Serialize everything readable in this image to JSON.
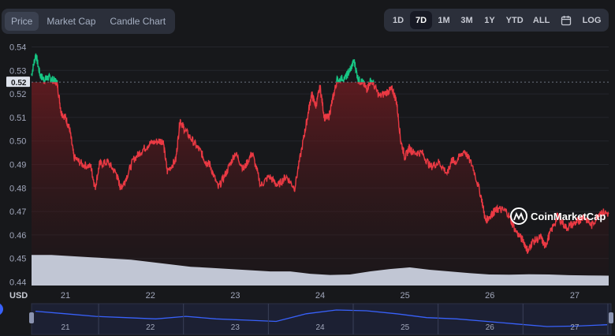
{
  "tabs": [
    {
      "label": "Price",
      "active": true
    },
    {
      "label": "Market Cap",
      "active": false
    },
    {
      "label": "Candle Chart",
      "active": false
    }
  ],
  "ranges": [
    {
      "label": "1D",
      "active": false
    },
    {
      "label": "7D",
      "active": true
    },
    {
      "label": "1M",
      "active": false
    },
    {
      "label": "3M",
      "active": false
    },
    {
      "label": "1Y",
      "active": false
    },
    {
      "label": "YTD",
      "active": false
    },
    {
      "label": "ALL",
      "active": false
    },
    {
      "icon": "calendar-icon"
    },
    {
      "label": "LOG",
      "active": false
    }
  ],
  "watermark": "CoinMarketCap",
  "colors": {
    "up": "#16c784",
    "down": "#ea3943",
    "background": "#17181b",
    "volume": "#cfd6e4",
    "navigator_line": "#3861fb"
  },
  "chart_data": {
    "type": "line",
    "currency_label": "USD",
    "current_price_label": "0.52",
    "reference_price": 0.525,
    "y_ticks": [
      "0.54",
      "0.53",
      "0.52",
      "0.51",
      "0.50",
      "0.49",
      "0.48",
      "0.47",
      "0.46",
      "0.45",
      "0.44"
    ],
    "ylim": [
      0.4385,
      0.5415
    ],
    "x_ticks": [
      "21",
      "22",
      "23",
      "24",
      "25",
      "26",
      "27"
    ],
    "xlim": [
      20.6,
      27.4
    ],
    "grid": true,
    "series": [
      {
        "x": [
          20.6,
          20.65,
          20.7,
          20.75,
          20.8,
          20.85,
          20.9,
          20.95,
          21.0,
          21.05,
          21.1,
          21.2,
          21.3,
          21.35,
          21.4,
          21.5,
          21.6,
          21.65,
          21.7,
          21.8,
          21.9,
          22.0,
          22.1,
          22.15,
          22.2,
          22.3,
          22.35,
          22.4,
          22.5,
          22.6,
          22.65,
          22.7,
          22.8,
          22.9,
          23.0,
          23.1,
          23.2,
          23.3,
          23.4,
          23.5,
          23.6,
          23.7,
          23.8,
          23.85,
          23.9,
          23.95,
          24.0,
          24.05,
          24.1,
          24.15,
          24.2,
          24.3,
          24.35,
          24.4,
          24.45,
          24.5,
          24.55,
          24.6,
          24.7,
          24.8,
          24.85,
          24.9,
          24.95,
          25.0,
          25.05,
          25.1,
          25.2,
          25.3,
          25.4,
          25.5,
          25.55,
          25.6,
          25.7,
          25.8,
          25.9,
          25.95,
          26.0,
          26.05,
          26.1,
          26.2,
          26.3,
          26.4,
          26.45,
          26.5,
          26.6,
          26.65,
          26.7,
          26.8,
          26.9,
          27.0,
          27.05,
          27.1,
          27.2,
          27.3,
          27.4
        ],
        "y": [
          0.528,
          0.537,
          0.528,
          0.526,
          0.527,
          0.526,
          0.525,
          0.512,
          0.51,
          0.505,
          0.493,
          0.49,
          0.489,
          0.48,
          0.49,
          0.491,
          0.486,
          0.48,
          0.483,
          0.492,
          0.496,
          0.499,
          0.5,
          0.5,
          0.487,
          0.492,
          0.509,
          0.505,
          0.5,
          0.495,
          0.491,
          0.49,
          0.48,
          0.487,
          0.495,
          0.488,
          0.495,
          0.481,
          0.485,
          0.481,
          0.485,
          0.48,
          0.5,
          0.51,
          0.52,
          0.515,
          0.523,
          0.51,
          0.51,
          0.518,
          0.526,
          0.527,
          0.53,
          0.534,
          0.526,
          0.525,
          0.522,
          0.526,
          0.519,
          0.521,
          0.522,
          0.517,
          0.5,
          0.493,
          0.497,
          0.495,
          0.495,
          0.489,
          0.491,
          0.486,
          0.492,
          0.491,
          0.496,
          0.489,
          0.476,
          0.466,
          0.468,
          0.47,
          0.471,
          0.47,
          0.462,
          0.457,
          0.453,
          0.457,
          0.459,
          0.455,
          0.46,
          0.468,
          0.463,
          0.465,
          0.466,
          0.468,
          0.464,
          0.47,
          0.469
        ]
      }
    ],
    "volume_profile": [
      0.4515,
      0.4515,
      0.451,
      0.4505,
      0.45,
      0.4495,
      0.4485,
      0.4475,
      0.4465,
      0.446,
      0.4455,
      0.445,
      0.4445,
      0.4445,
      0.4435,
      0.443,
      0.4432,
      0.4445,
      0.4455,
      0.4462,
      0.4452,
      0.4445,
      0.4438,
      0.4432,
      0.4431,
      0.4433,
      0.4432,
      0.4429,
      0.4428,
      0.4427
    ],
    "navigator": {
      "x_ticks": [
        "21",
        "22",
        "23",
        "24",
        "25",
        "26",
        "27"
      ],
      "series": [
        0.52,
        0.51,
        0.5,
        0.495,
        0.49,
        0.5,
        0.49,
        0.485,
        0.48,
        0.51,
        0.525,
        0.522,
        0.51,
        0.495,
        0.49,
        0.48,
        0.47,
        0.46,
        0.462,
        0.467
      ]
    }
  }
}
